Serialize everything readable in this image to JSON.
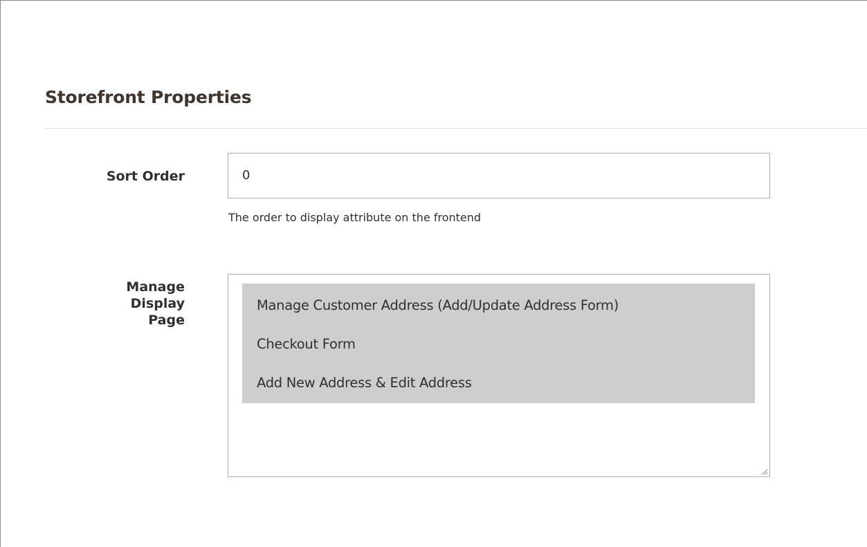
{
  "section": {
    "title": "Storefront Properties"
  },
  "sort_order": {
    "label": "Sort Order",
    "value": "0",
    "note": "The order to display attribute on the frontend"
  },
  "manage_display_page": {
    "label_lines": [
      "Manage",
      "Display",
      "Page"
    ],
    "options": [
      {
        "label": "Manage Customer Address (Add/Update Address Form)",
        "selected": true
      },
      {
        "label": "Checkout Form",
        "selected": true
      },
      {
        "label": "Add New Address & Edit Address",
        "selected": true
      }
    ]
  },
  "colors": {
    "selected_option_bg": "#cecece",
    "input_border": "#adadad",
    "divider": "#e3e3e3",
    "title_text": "#41362f"
  }
}
